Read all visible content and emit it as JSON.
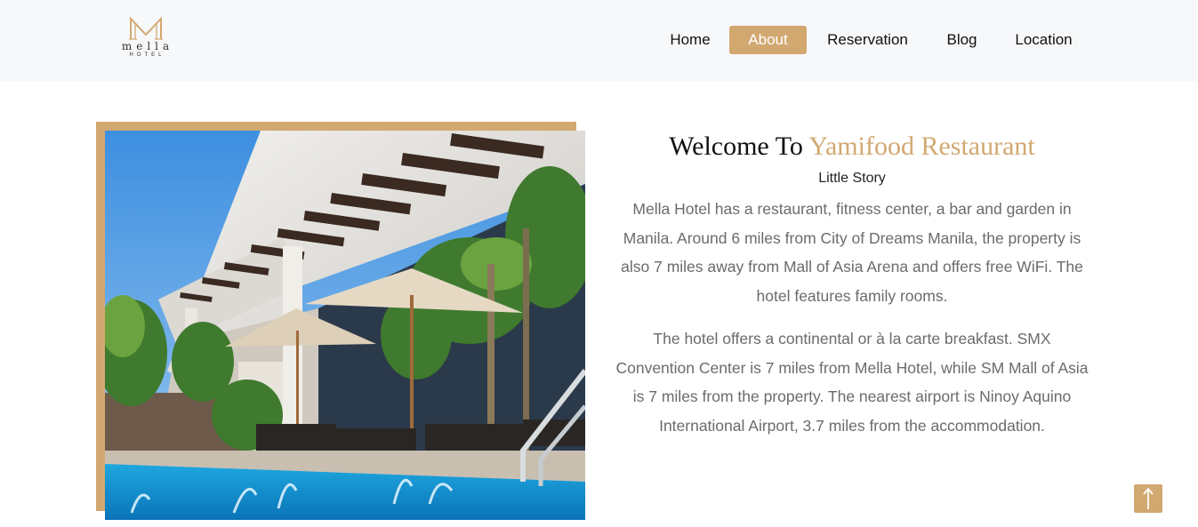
{
  "brand": {
    "name": "mella",
    "sub": "HOTEL",
    "accent_color": "#d2a871"
  },
  "nav": {
    "items": [
      {
        "label": "Home",
        "active": false
      },
      {
        "label": "About",
        "active": true
      },
      {
        "label": "Reservation",
        "active": false
      },
      {
        "label": "Blog",
        "active": false
      },
      {
        "label": "Location",
        "active": false
      }
    ]
  },
  "about": {
    "title_prefix": "Welcome To",
    "title_highlight": "Yamifood Restaurant",
    "subtitle": "Little Story",
    "paragraphs": [
      "Mella Hotel has a restaurant, fitness center, a bar and garden in Manila. Around 6 miles from City of Dreams Manila, the property is also 7 miles away from Mall of Asia Arena and offers free WiFi. The hotel features family rooms.",
      "The hotel offers a continental or à la carte breakfast. SMX Convention Center is 7 miles from Mella Hotel, while SM Mall of Asia is 7 miles from the property. The nearest airport is Ninoy Aquino International Airport, 3.7 miles from the accommodation."
    ]
  },
  "icons": {
    "scroll_top": "arrow-up-icon"
  }
}
